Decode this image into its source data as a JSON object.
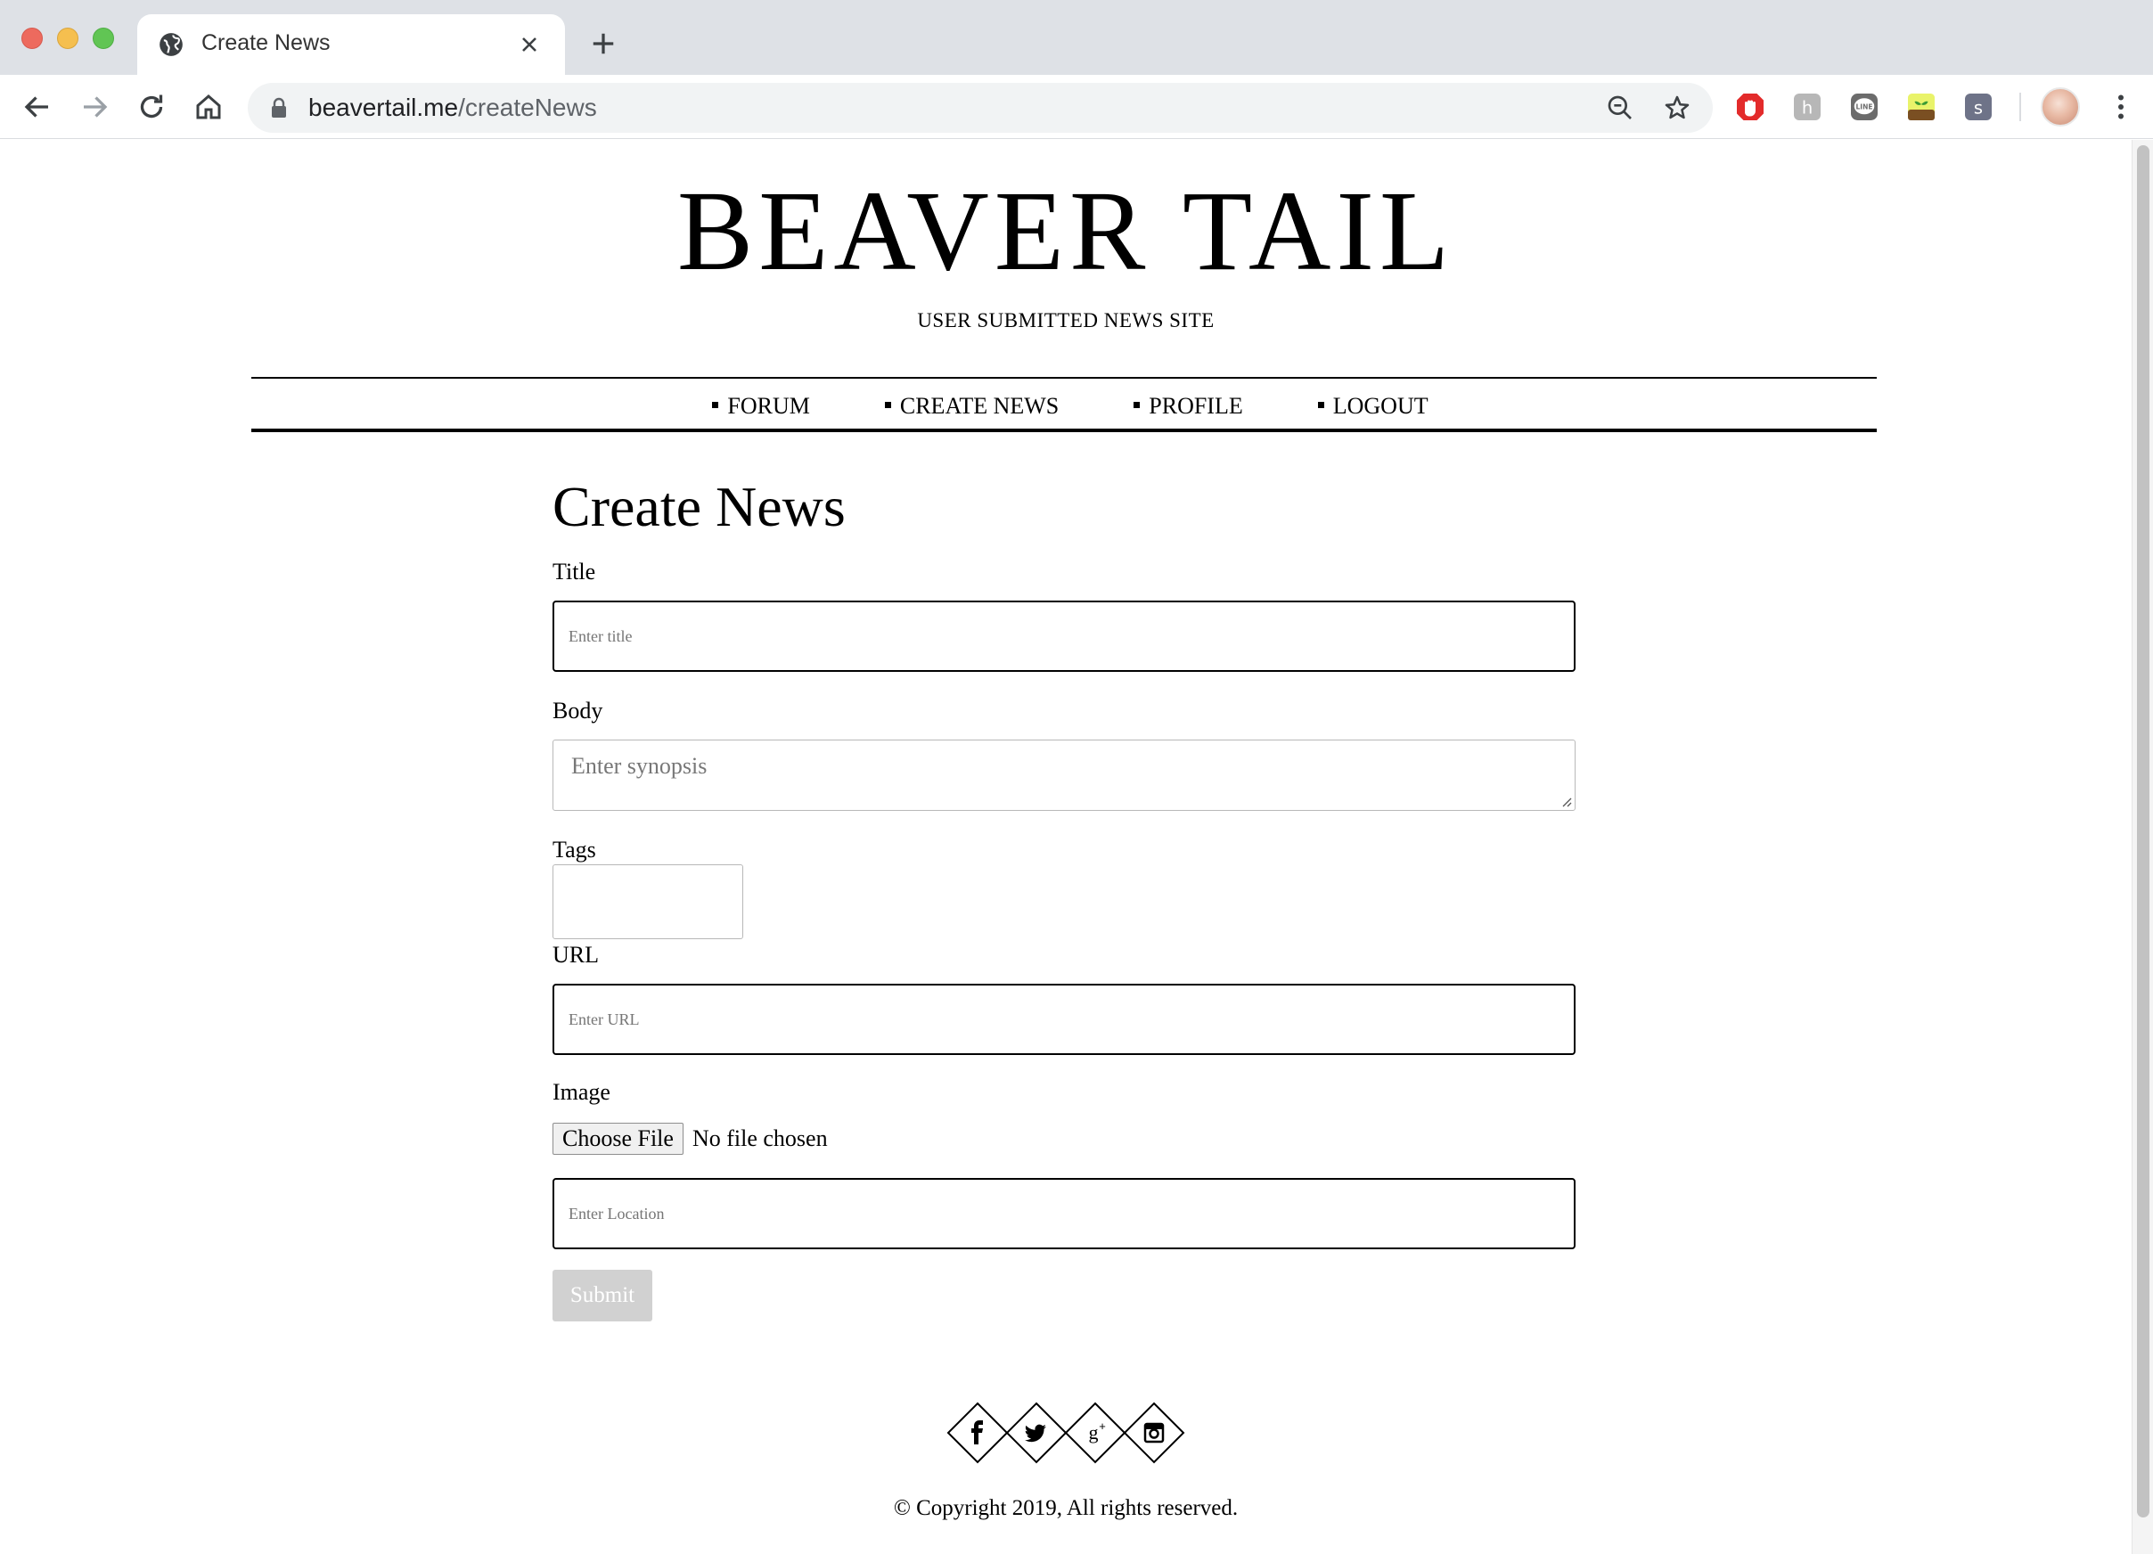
{
  "browser": {
    "tab_title": "Create News",
    "url_host": "beavertail.me",
    "url_path": "/createNews",
    "colors": {
      "tabstrip": "#dee1e6",
      "omnibox": "#f1f3f4"
    },
    "extensions": [
      "adblock-icon",
      "extension-h-icon",
      "line-icon",
      "plant-icon",
      "extension-s-icon"
    ]
  },
  "site": {
    "title": "BEAVER TAIL",
    "subtitle": "USER SUBMITTED NEWS SITE"
  },
  "nav": {
    "items": [
      {
        "label": "FORUM"
      },
      {
        "label": "CREATE NEWS"
      },
      {
        "label": "PROFILE"
      },
      {
        "label": "LOGOUT"
      }
    ]
  },
  "form": {
    "heading": "Create News",
    "title_label": "Title",
    "title_placeholder": "Enter title",
    "body_label": "Body",
    "body_placeholder": "Enter synopsis",
    "tags_label": "Tags",
    "url_label": "URL",
    "url_placeholder": "Enter URL",
    "image_label": "Image",
    "file_button": "Choose File",
    "file_status": "No file chosen",
    "location_placeholder": "Enter Location",
    "submit_label": "Submit",
    "submit_color": "#d1d1d1"
  },
  "footer": {
    "social_icons": [
      "facebook-icon",
      "twitter-icon",
      "google-plus-icon",
      "instagram-icon"
    ],
    "copyright": "© Copyright 2019, All rights reserved."
  }
}
